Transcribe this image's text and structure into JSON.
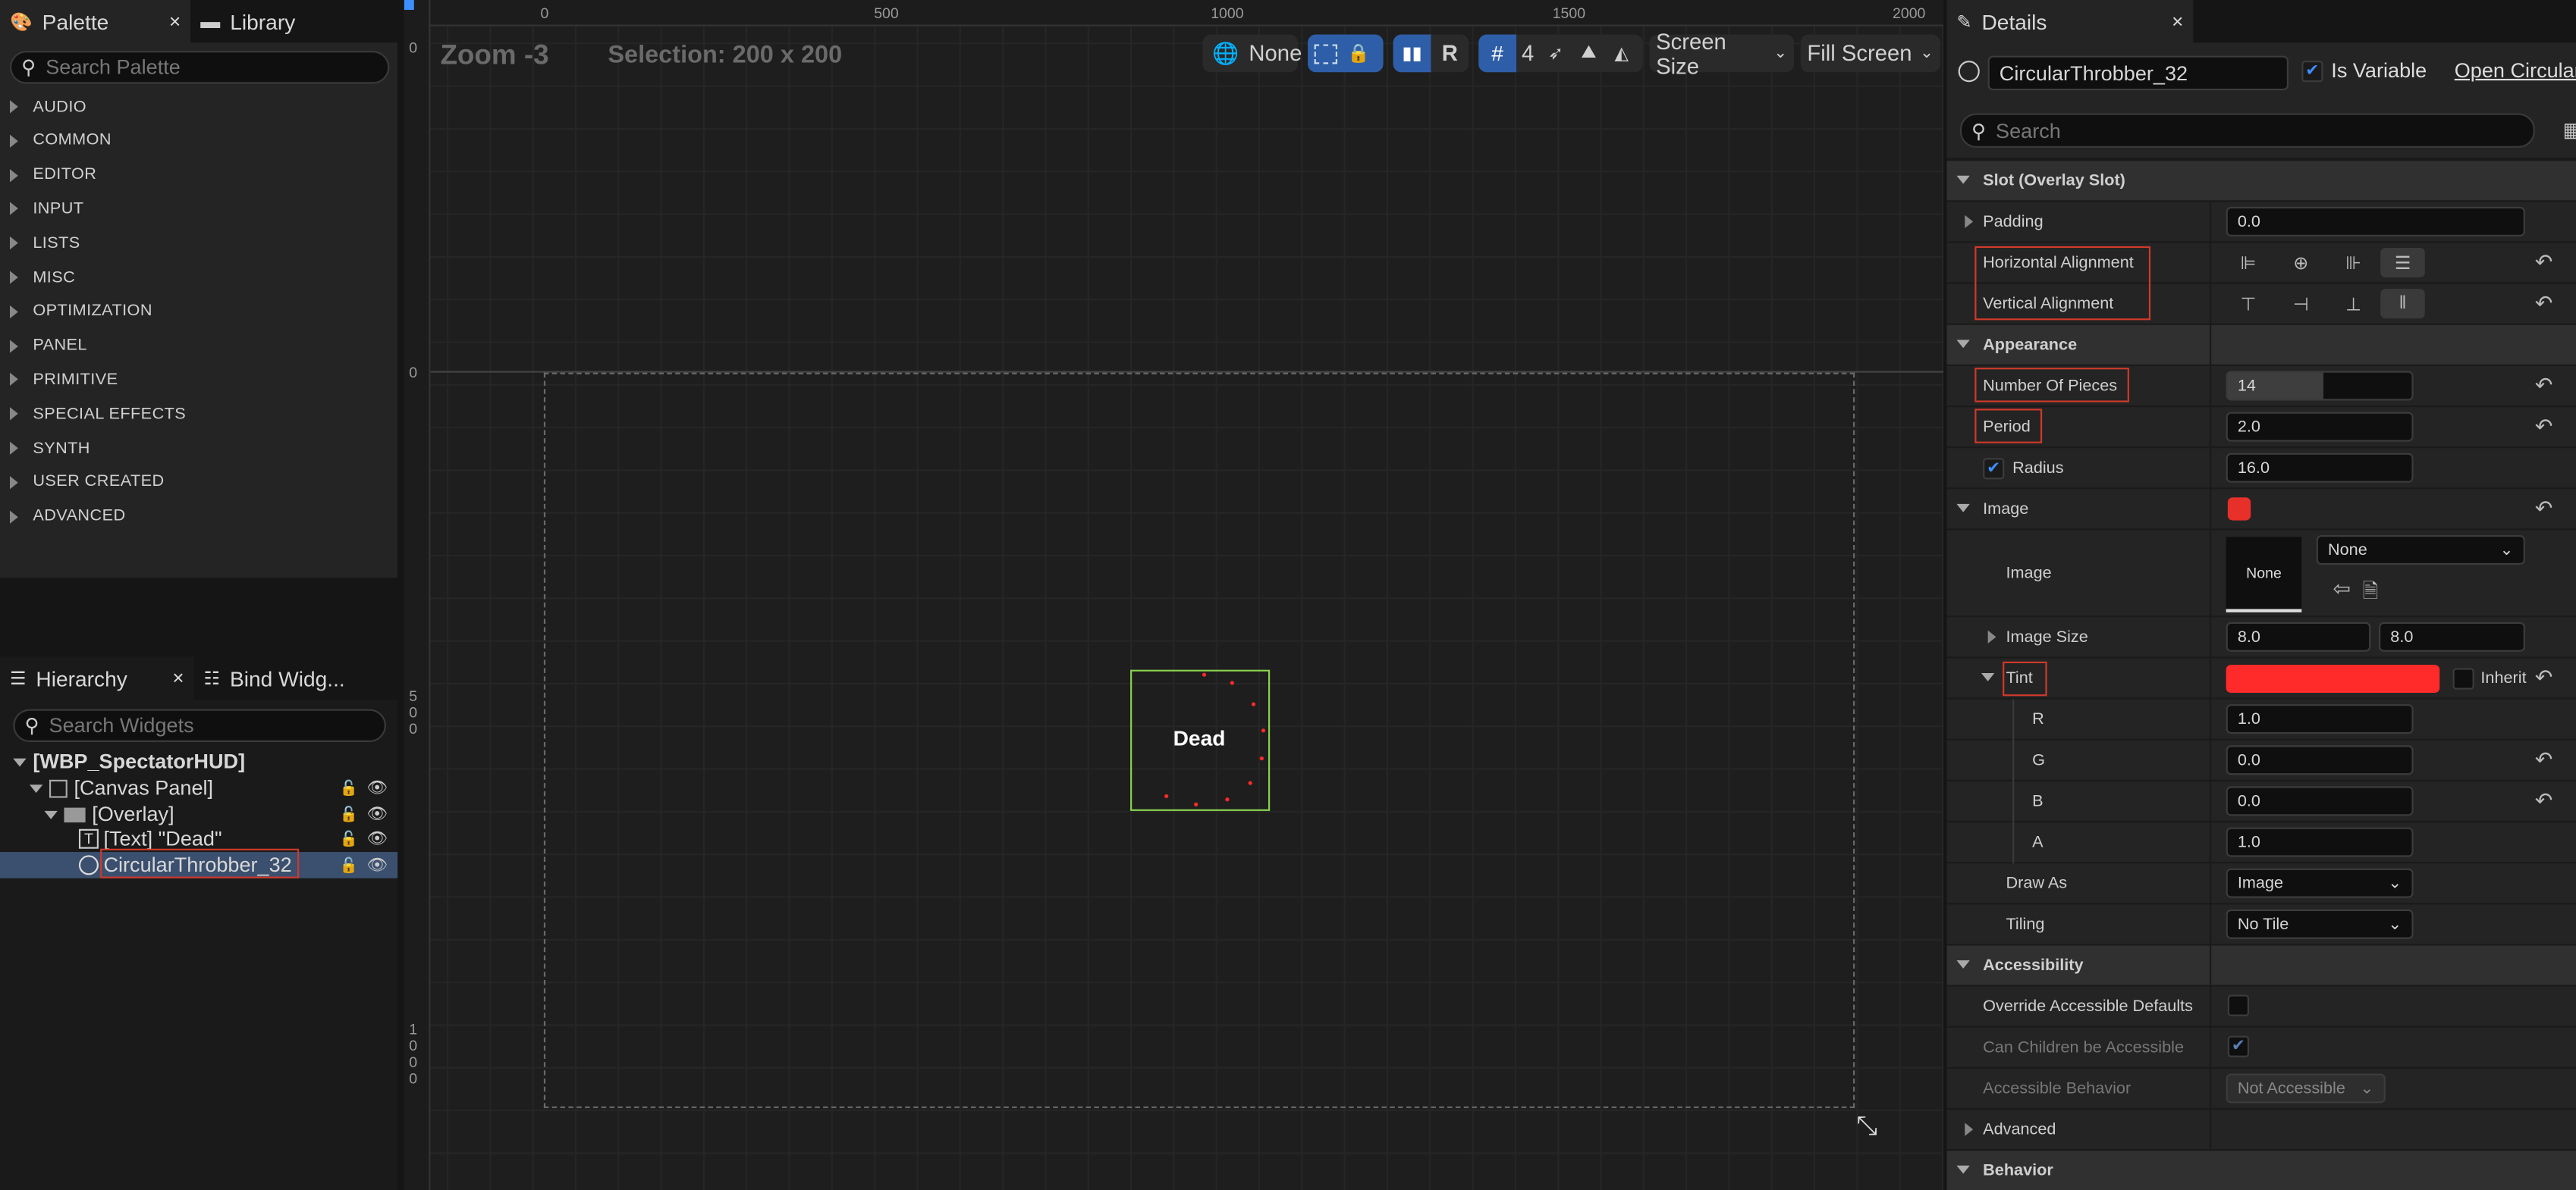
{
  "palette": {
    "tab_label": "Palette",
    "tab_close": "×",
    "library_label": "Library",
    "search_placeholder": "Search Palette",
    "categories": [
      "AUDIO",
      "COMMON",
      "EDITOR",
      "INPUT",
      "LISTS",
      "MISC",
      "OPTIMIZATION",
      "PANEL",
      "PRIMITIVE",
      "SPECIAL EFFECTS",
      "SYNTH",
      "USER CREATED",
      "ADVANCED"
    ]
  },
  "hierarchy": {
    "tab_label": "Hierarchy",
    "tab_close": "×",
    "bind_label": "Bind Widg...",
    "search_placeholder": "Search Widgets",
    "root": "[WBP_SpectatorHUD]",
    "canvas_panel": "[Canvas Panel]",
    "overlay": "[Overlay]",
    "text_item": "[Text] \"Dead\"",
    "throbber": "CircularThrobber_32"
  },
  "canvas": {
    "zoom": "Zoom -3",
    "selection": "Selection: 200 x 200",
    "toolbar": {
      "none_label": "None",
      "r_label": "R",
      "grid_value": "4",
      "screen_size": "Screen Size",
      "fill_screen": "Fill Screen"
    },
    "ruler_h": [
      "0",
      "500",
      "1000",
      "1500",
      "2000"
    ],
    "ruler_v": [
      "0",
      "0",
      "5",
      "0",
      "0",
      "1",
      "0",
      "0",
      "0"
    ],
    "widget_text": "Dead"
  },
  "details": {
    "tab_label": "Details",
    "tab_close": "×",
    "name": "CircularThrobber_32",
    "is_variable": "Is Variable",
    "open_link": "Open Circular",
    "search_placeholder": "Search",
    "slot_section": "Slot (Overlay Slot)",
    "padding_label": "Padding",
    "padding_value": "0.0",
    "h_align_label": "Horizontal Alignment",
    "v_align_label": "Vertical Alignment",
    "appearance_section": "Appearance",
    "pieces_label": "Number Of Pieces",
    "pieces_value": "14",
    "period_label": "Period",
    "period_value": "2.0",
    "radius_label": "Radius",
    "radius_value": "16.0",
    "image_label": "Image",
    "image_sub_label": "Image",
    "image_none_thumb": "None",
    "image_dropdown": "None",
    "image_size_label": "Image Size",
    "image_size_x": "8.0",
    "image_size_y": "8.0",
    "tint_label": "Tint",
    "inherit_label": "Inherit",
    "r_label": "R",
    "r_value": "1.0",
    "g_label": "G",
    "g_value": "0.0",
    "b_label": "B",
    "b_value": "0.0",
    "a_label": "A",
    "a_value": "1.0",
    "draw_as_label": "Draw As",
    "draw_as_value": "Image",
    "tiling_label": "Tiling",
    "tiling_value": "No Tile",
    "accessibility_section": "Accessibility",
    "override_label": "Override Accessible Defaults",
    "children_label": "Can Children be Accessible",
    "behavior_label": "Accessible Behavior",
    "behavior_value": "Not Accessible",
    "advanced_section": "Advanced",
    "behavior_section": "Behavior",
    "tint_color": "#ff2b2b",
    "accent": "#3d8fff"
  }
}
